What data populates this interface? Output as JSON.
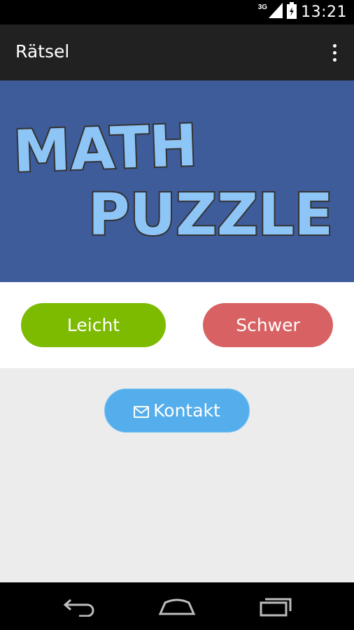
{
  "status_bar": {
    "network_type": "3G",
    "time": "13:21"
  },
  "action_bar": {
    "title": "Rätsel"
  },
  "banner": {
    "logo_line1": "MATH",
    "logo_line2": "PUZZLE"
  },
  "difficulty": {
    "easy_label": "Leicht",
    "hard_label": "Schwer"
  },
  "contact": {
    "label": "Kontakt"
  },
  "colors": {
    "banner_bg": "#3e5c9a",
    "easy": "#7cbb00",
    "hard": "#d86163",
    "contact": "#55aeec",
    "logo_fill": "#8ec5f7"
  }
}
